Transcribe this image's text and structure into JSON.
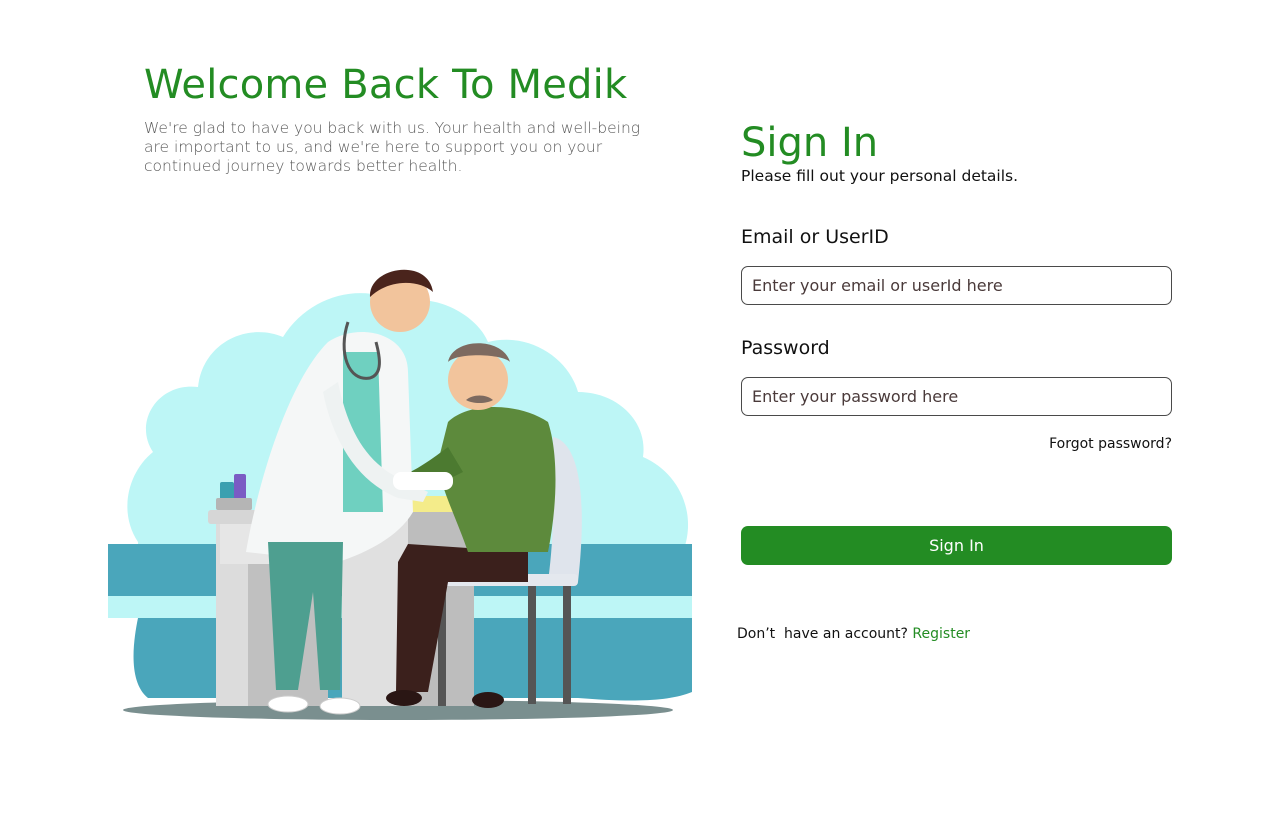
{
  "welcome": {
    "title": "Welcome Back To Medik",
    "text": "We're glad to have you back with us. Your health and well-being are important to us, and we're here to support you on your continued journey towards better health."
  },
  "signin": {
    "title": "Sign In",
    "subtitle": "Please fill out your personal details.",
    "email_label": "Email or UserID",
    "email_placeholder": "Enter your email or userId here",
    "password_label": "Password",
    "password_placeholder": "Enter your password here",
    "forgot_label": "Forgot password?",
    "button_label": "Sign In",
    "no_account_text": "Don’t  have an account? ",
    "register_label": "Register"
  },
  "colors": {
    "brand": "#238c23",
    "input_border": "#4a4a4a"
  }
}
